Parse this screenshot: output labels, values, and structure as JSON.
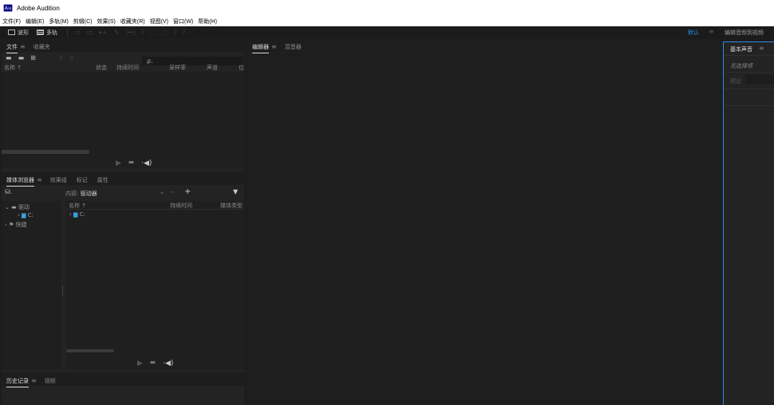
{
  "app": {
    "logo_text": "Au",
    "title": "Adobe Audition"
  },
  "menu": [
    "文件(F)",
    "编辑(E)",
    "多轨(M)",
    "剪辑(C)",
    "效果(S)",
    "收藏夹(R)",
    "视图(V)",
    "窗口(W)",
    "帮助(H)"
  ],
  "toolbar": {
    "waveform_label": "波形",
    "multitrack_label": "多轨",
    "workspace_default": "默认",
    "workspace_menu_icon": "≡",
    "workspace_edit": "编辑音频到视频"
  },
  "files_panel": {
    "tabs": [
      {
        "label": "文件",
        "active": true
      },
      {
        "label": "收藏夹",
        "active": false
      }
    ],
    "search_placeholder": "ρ.",
    "columns": [
      "名称 ↑",
      "状态",
      "持续时间",
      "采样率",
      "声道",
      "位"
    ]
  },
  "media_panel": {
    "tabs": [
      {
        "label": "媒体浏览器",
        "active": true
      },
      {
        "label": "效果组",
        "active": false
      },
      {
        "label": "标记",
        "active": false
      },
      {
        "label": "属性",
        "active": false
      }
    ],
    "content_label": "内容:",
    "content_value": "驱动器",
    "tree": {
      "drives": "驱动",
      "drive_c": "C:",
      "shortcuts": "快捷"
    },
    "columns": [
      "名称 ↑",
      "持续时间",
      "媒体类型"
    ],
    "list_item": "C:"
  },
  "history_panel": {
    "tabs": [
      {
        "label": "历史记录",
        "active": true
      },
      {
        "label": "视频",
        "active": false
      }
    ]
  },
  "editor_panel": {
    "tabs": [
      {
        "label": "编辑器",
        "active": true
      },
      {
        "label": "混音器",
        "active": false
      }
    ]
  },
  "essential_sound": {
    "tab": "基本声音",
    "no_selection": "无选择项",
    "preset_label": "预设"
  },
  "colors": {
    "accent": "#2d8ceb",
    "background": "#1d1d1d",
    "panel": "#232323"
  }
}
